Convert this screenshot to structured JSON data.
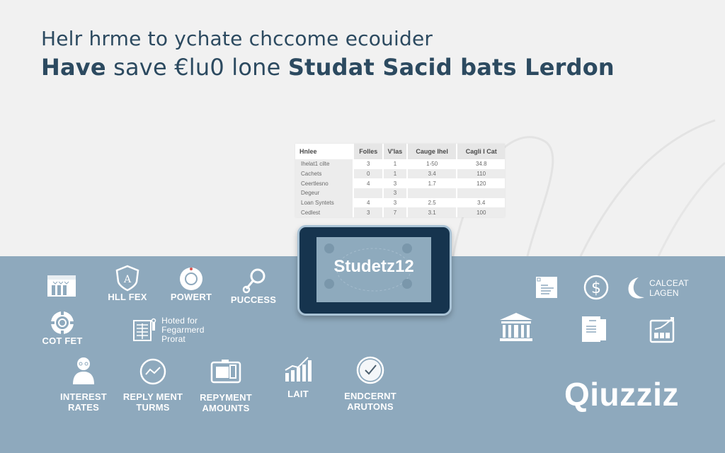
{
  "header": {
    "line1": "Helr hrme to ychate chccome ecouider",
    "line2_parts": [
      "Have",
      " save €lu0 lone ",
      "Studat Sacid bats Lerdon"
    ]
  },
  "table": {
    "columns": [
      "Hnlee",
      "Folles",
      "V'las",
      "Cauge Ihel",
      "Cagli I Cat"
    ],
    "rows": [
      [
        "Ihelat1 cilte",
        "3",
        "1",
        "1-50",
        "34.8"
      ],
      [
        "Cachets",
        "0",
        "1",
        "3.4",
        "110"
      ],
      [
        "Ceertlesno",
        "4",
        "3",
        "1.7",
        "120"
      ],
      [
        "Degeur",
        "",
        "3",
        "",
        ""
      ],
      [
        "Loan Syntets",
        "4",
        "3",
        "2.5",
        "3.4"
      ],
      [
        "Cedlest",
        "3",
        "7",
        "3.1",
        "100"
      ]
    ]
  },
  "tablet": {
    "brand": "Studetz12"
  },
  "features_left": [
    {
      "icon": "storefront-icon",
      "label": ""
    },
    {
      "icon": "shield-icon",
      "label": "HLL FEX"
    },
    {
      "icon": "lifebuoy-icon",
      "label": "POWERT"
    },
    {
      "icon": "magnifier-icon",
      "label": "PUCCESS"
    },
    {
      "icon": "chip-icon",
      "label": "COT FET"
    },
    {
      "icon": "document-icon",
      "label_lines": [
        "Hoted for",
        "Fegarmerd",
        "Prorat"
      ]
    }
  ],
  "features_bottom": [
    {
      "icon": "person-icon",
      "label_lines": [
        "INTEREST",
        "RATES"
      ]
    },
    {
      "icon": "clock-graph-icon",
      "label_lines": [
        "REPLY MENT",
        "TURMS"
      ]
    },
    {
      "icon": "card-icon",
      "label_lines": [
        "REPYMENT",
        "AMOUNTS"
      ]
    },
    {
      "icon": "growth-chart-icon",
      "label_lines": [
        "LAIT"
      ]
    },
    {
      "icon": "check-clock-icon",
      "label_lines": [
        "ENDCERNT",
        "ARUTONS"
      ]
    }
  ],
  "features_right": [
    {
      "icon": "browser-doc-icon",
      "label": ""
    },
    {
      "icon": "dollar-coin-icon",
      "label": ""
    },
    {
      "icon": "moon-icon",
      "label_lines": [
        "CALCEAT",
        "LAGEN"
      ]
    },
    {
      "icon": "bank-icon",
      "label": ""
    },
    {
      "icon": "files-icon",
      "label": ""
    },
    {
      "icon": "trend-board-icon",
      "label": ""
    }
  ],
  "logo": "Qiuzziz",
  "colors": {
    "title": "#2c4a60",
    "panel": "#8ea9bd",
    "tablet_frame": "#16344e",
    "background": "#f1f1f1"
  }
}
